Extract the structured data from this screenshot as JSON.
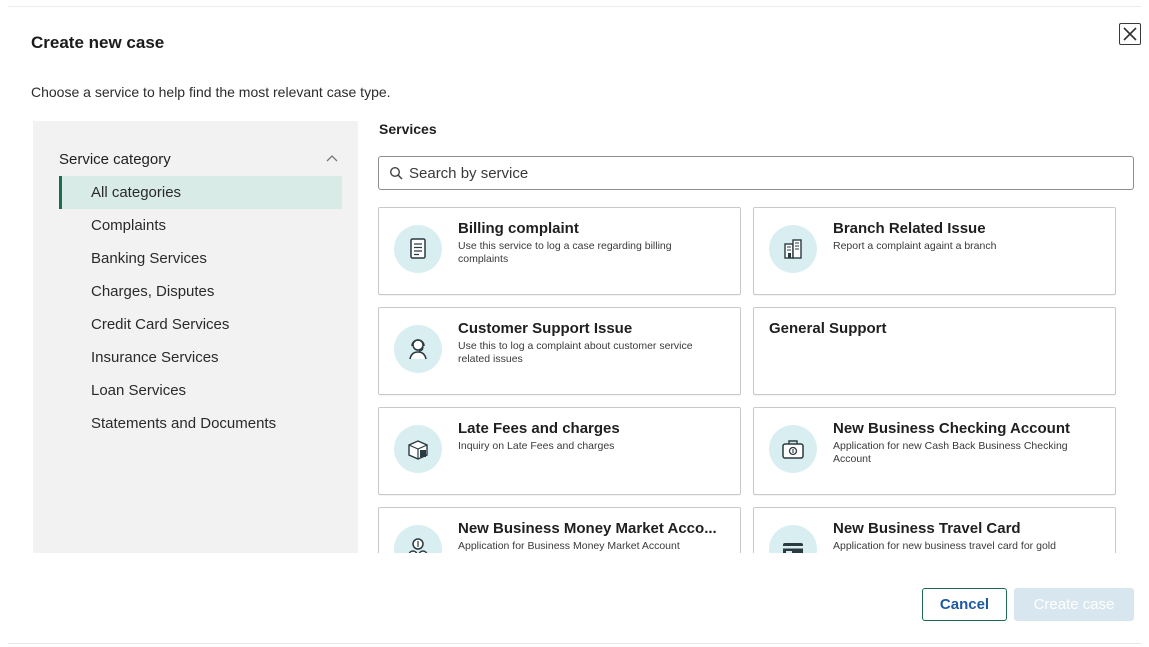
{
  "dialog": {
    "title": "Create new case",
    "subtitle": "Choose a service to help find the most relevant case type.",
    "close_icon": "close-icon"
  },
  "sidebar": {
    "header": "Service category",
    "header_icon": "chevron-up-icon",
    "items": [
      {
        "label": "All categories",
        "active": true
      },
      {
        "label": "Complaints",
        "active": false
      },
      {
        "label": "Banking Services",
        "active": false
      },
      {
        "label": "Charges, Disputes",
        "active": false
      },
      {
        "label": "Credit Card Services",
        "active": false
      },
      {
        "label": "Insurance Services",
        "active": false
      },
      {
        "label": "Loan Services",
        "active": false
      },
      {
        "label": "Statements and Documents",
        "active": false
      }
    ]
  },
  "services": {
    "label": "Services",
    "search": {
      "placeholder": "Search by service",
      "value": "",
      "icon": "search-icon"
    },
    "cards": [
      {
        "title": "Billing complaint",
        "desc": "Use this service to log a case regarding billing complaints",
        "icon": "document-icon"
      },
      {
        "title": "Branch Related Issue",
        "desc": "Report a complaint againt a branch",
        "icon": "building-icon"
      },
      {
        "title": "Customer Support Issue",
        "desc": "Use this to log a complaint about customer service related issues",
        "icon": "support-agent-icon"
      },
      {
        "title": "General Support",
        "desc": "",
        "icon": ""
      },
      {
        "title": "Late Fees and charges",
        "desc": "Inquiry on Late Fees and charges",
        "icon": "fees-box-icon"
      },
      {
        "title": "New Business Checking Account",
        "desc": "Application for new Cash Back Business Checking Account",
        "icon": "briefcase-money-icon"
      },
      {
        "title": "New Business Money Market Acco...",
        "desc": "Application for Business Money Market Account",
        "icon": "money-coins-icon"
      },
      {
        "title": "New Business Travel Card",
        "desc": "Application for new business travel card for gold",
        "icon": "credit-card-icon"
      }
    ]
  },
  "footer": {
    "cancel_label": "Cancel",
    "create_label": "Create case"
  },
  "colors": {
    "accent": "#1d6b55",
    "active_bg": "#d9ebe6",
    "icon_bg": "#d9eef1",
    "link_blue": "#1d5aa0",
    "disabled_btn": "#d7e6ef"
  }
}
